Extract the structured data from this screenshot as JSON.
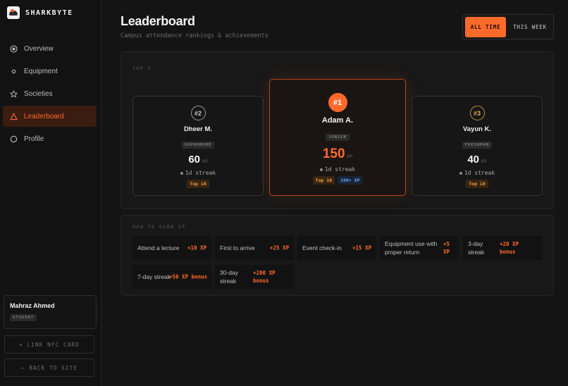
{
  "brand": {
    "name": "SHARKBYTE"
  },
  "nav": {
    "items": [
      {
        "label": "Overview",
        "icon": "target-icon"
      },
      {
        "label": "Equipment",
        "icon": "dot-icon"
      },
      {
        "label": "Societies",
        "icon": "star-icon"
      },
      {
        "label": "Leaderboard",
        "icon": "triangle-icon",
        "active": true
      },
      {
        "label": "Profile",
        "icon": "circle-icon"
      }
    ]
  },
  "user": {
    "name": "Mahraz Ahmed",
    "role": "STUDENT"
  },
  "sidebar_actions": {
    "link_nfc": "+ LINK NFC CARD",
    "back": "← BACK TO SITE"
  },
  "header": {
    "title": "Leaderboard",
    "subtitle": "Campus attendance rankings & achievements",
    "filter": {
      "all_time": "ALL TIME",
      "this_week": "THIS WEEK",
      "selected": "ALL TIME"
    }
  },
  "top3": {
    "label": "TOP 3",
    "entries": [
      {
        "rank": "#2",
        "name": "Dheer M.",
        "year": "SOPHOMORE",
        "xp": "60",
        "unit": "XP",
        "streak": "1d streak",
        "badges": [
          "Top 10"
        ]
      },
      {
        "rank": "#1",
        "name": "Adam A.",
        "year": "JUNIOR",
        "xp": "150",
        "unit": "XP",
        "streak": "1d streak",
        "badges": [
          "Top 10",
          "100+ XP"
        ]
      },
      {
        "rank": "#3",
        "name": "Vayun K.",
        "year": "FRESHMAN",
        "xp": "40",
        "unit": "XP",
        "streak": "1d streak",
        "badges": [
          "Top 10"
        ]
      }
    ]
  },
  "earn": {
    "label": "HOW TO EARN XP",
    "items": [
      {
        "label": "Attend a lecture",
        "points": "+10 XP"
      },
      {
        "label": "First to arrive",
        "points": "+25 XP"
      },
      {
        "label": "Event check-in",
        "points": "+15 XP"
      },
      {
        "label": "Equipment use with proper return",
        "points": "+5 XP"
      },
      {
        "label": "3-day streak",
        "points": "+20 XP bonus"
      },
      {
        "label": "7-day streak",
        "points": "+50 XP bonus"
      },
      {
        "label": "30-day streak",
        "points": "+200 XP bonus"
      }
    ]
  },
  "colors": {
    "accent": "#ff6a2b",
    "background": "#141414",
    "gold": "#e8a24a",
    "blue": "#6aa0ea"
  }
}
